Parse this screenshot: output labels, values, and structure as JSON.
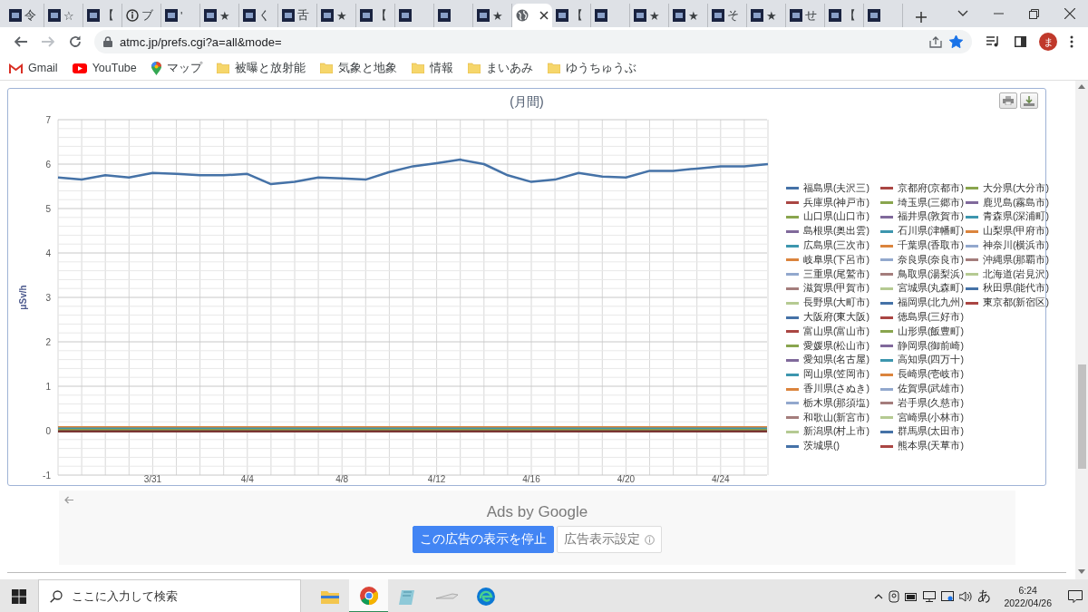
{
  "browser": {
    "tabs": [
      {
        "kind": "site",
        "title": "令",
        "selected": false
      },
      {
        "kind": "site",
        "title": "☆",
        "selected": false
      },
      {
        "kind": "site",
        "title": "【",
        "selected": false
      },
      {
        "kind": "info",
        "title": "ブ",
        "selected": false
      },
      {
        "kind": "site",
        "title": "'",
        "selected": false
      },
      {
        "kind": "site",
        "title": "★",
        "selected": false
      },
      {
        "kind": "site",
        "title": "く",
        "selected": false
      },
      {
        "kind": "site",
        "title": "舌",
        "selected": false
      },
      {
        "kind": "site",
        "title": "★",
        "selected": false
      },
      {
        "kind": "site",
        "title": "【",
        "selected": false
      },
      {
        "kind": "site",
        "selected": false
      },
      {
        "kind": "site",
        "selected": false
      },
      {
        "kind": "site",
        "title": "★",
        "selected": false
      },
      {
        "kind": "globe",
        "selected": true
      },
      {
        "kind": "site",
        "title": "【",
        "selected": false
      },
      {
        "kind": "site",
        "selected": false
      },
      {
        "kind": "site",
        "title": "★",
        "selected": false
      },
      {
        "kind": "site",
        "title": "★",
        "selected": false
      },
      {
        "kind": "site",
        "title": "そ",
        "selected": false
      },
      {
        "kind": "site",
        "title": "★",
        "selected": false
      },
      {
        "kind": "site",
        "title": "せ",
        "selected": false
      },
      {
        "kind": "site",
        "title": "【",
        "selected": false
      },
      {
        "kind": "site",
        "selected": false
      }
    ],
    "address": "atmc.jp/prefs.cgi?a=all&mode=",
    "bookmarked": true,
    "profile": "ま",
    "bookmarks": [
      {
        "kind": "gmail",
        "label": "Gmail"
      },
      {
        "kind": "youtube",
        "label": "YouTube"
      },
      {
        "kind": "maps",
        "label": "マップ"
      },
      {
        "kind": "folder",
        "label": "被曝と放射能"
      },
      {
        "kind": "folder",
        "label": "気象と地象"
      },
      {
        "kind": "folder",
        "label": "情報"
      },
      {
        "kind": "folder",
        "label": "まいあみ"
      },
      {
        "kind": "folder",
        "label": "ゆうちゅうぶ"
      }
    ]
  },
  "chart": {
    "chart_data": {
      "type": "line",
      "title": "(月間)",
      "ylabel": "μSv/h",
      "grid": true,
      "categories": [
        null,
        null,
        null,
        null,
        "3/31",
        null,
        null,
        null,
        "4/4",
        null,
        null,
        null,
        "4/8",
        null,
        null,
        null,
        "4/12",
        null,
        null,
        null,
        "4/16",
        null,
        null,
        null,
        "4/20",
        null,
        null,
        null,
        "4/24",
        null,
        null
      ],
      "ylim": [
        -1,
        7
      ],
      "yticks": [
        -1,
        0,
        1,
        2,
        3,
        4,
        5,
        6,
        7
      ],
      "series": [
        {
          "name": "福島県(夫沢三)",
          "color": "#4572a7",
          "values": [
            5.7,
            5.65,
            5.75,
            5.7,
            5.8,
            5.78,
            5.75,
            5.75,
            5.78,
            5.55,
            5.6,
            5.7,
            5.68,
            5.65,
            5.82,
            5.95,
            6.02,
            6.1,
            6.0,
            5.75,
            5.6,
            5.65,
            5.8,
            5.72,
            5.7,
            5.85,
            5.85,
            5.9,
            5.95,
            5.95,
            6.0
          ]
        }
      ]
    },
    "legend": [
      {
        "name": "京都府(京都市)",
        "color": "#aa4643"
      },
      {
        "name": "大分県(大分市)",
        "color": "#89a54e"
      },
      {
        "name": "兵庫県(神戸市)",
        "color": "#aa4643"
      },
      {
        "name": "埼玉県(三郷市)",
        "color": "#89a54e"
      },
      {
        "name": "鹿児島(霧島市)",
        "color": "#80699b"
      },
      {
        "name": "山口県(山口市)",
        "color": "#89a54e"
      },
      {
        "name": "福井県(敦賀市)",
        "color": "#80699b"
      },
      {
        "name": "青森県(深浦町)",
        "color": "#3d96ae"
      },
      {
        "name": "島根県(奥出雲)",
        "color": "#80699b"
      },
      {
        "name": "石川県(津幡町)",
        "color": "#3d96ae"
      },
      {
        "name": "山梨県(甲府市)",
        "color": "#db843d"
      },
      {
        "name": "広島県(三次市)",
        "color": "#3d96ae"
      },
      {
        "name": "千葉県(香取市)",
        "color": "#db843d"
      },
      {
        "name": "神奈川(横浜市)",
        "color": "#92a8cd"
      },
      {
        "name": "岐阜県(下呂市)",
        "color": "#db843d"
      },
      {
        "name": "奈良県(奈良市)",
        "color": "#92a8cd"
      },
      {
        "name": "沖縄県(那覇市)",
        "color": "#a47d7c"
      },
      {
        "name": "三重県(尾鷲市)",
        "color": "#92a8cd"
      },
      {
        "name": "鳥取県(湯梨浜)",
        "color": "#a47d7c"
      },
      {
        "name": "北海道(岩見沢)",
        "color": "#b5ca92"
      },
      {
        "name": "滋賀県(甲賀市)",
        "color": "#a47d7c"
      },
      {
        "name": "宮城県(丸森町)",
        "color": "#b5ca92"
      },
      {
        "name": "秋田県(能代市)",
        "color": "#4572a7"
      },
      {
        "name": "長野県(大町市)",
        "color": "#b5ca92"
      },
      {
        "name": "福岡県(北九州)",
        "color": "#4572a7"
      },
      {
        "name": "東京都(新宿区)",
        "color": "#aa4643"
      },
      {
        "name": "大阪府(東大阪)",
        "color": "#4572a7"
      },
      {
        "name": "徳島県(三好市)",
        "color": "#aa4643"
      },
      {
        "name": "富山県(富山市)",
        "color": "#aa4643"
      },
      {
        "name": "山形県(飯豊町)",
        "color": "#89a54e"
      },
      {
        "name": "愛媛県(松山市)",
        "color": "#89a54e"
      },
      {
        "name": "静岡県(御前崎)",
        "color": "#80699b"
      },
      {
        "name": "愛知県(名古屋)",
        "color": "#80699b"
      },
      {
        "name": "高知県(四万十)",
        "color": "#3d96ae"
      },
      {
        "name": "岡山県(笠岡市)",
        "color": "#3d96ae"
      },
      {
        "name": "長崎県(壱岐市)",
        "color": "#db843d"
      },
      {
        "name": "香川県(さぬき)",
        "color": "#db843d"
      },
      {
        "name": "佐賀県(武雄市)",
        "color": "#92a8cd"
      },
      {
        "name": "栃木県(那須塩)",
        "color": "#92a8cd"
      },
      {
        "name": "岩手県(久慈市)",
        "color": "#a47d7c"
      },
      {
        "name": "和歌山(新宮市)",
        "color": "#a47d7c"
      },
      {
        "name": "宮崎県(小林市)",
        "color": "#b5ca92"
      },
      {
        "name": "新潟県(村上市)",
        "color": "#b5ca92"
      },
      {
        "name": "群馬県(太田市)",
        "color": "#4572a7"
      },
      {
        "name": "茨城県()",
        "color": "#4572a7"
      },
      {
        "name": "熊本県(天草市)",
        "color": "#aa4643"
      }
    ]
  },
  "ads": {
    "label": "Ads by Google",
    "buttons": [
      {
        "kind": "primary",
        "label": "この広告の表示を停止"
      },
      {
        "kind": "secondary",
        "label": "広告表示設定"
      }
    ]
  },
  "taskbar": {
    "search_placeholder": "ここに入力して検索",
    "ime": "あ",
    "time": "6:24",
    "date": "2022/04/26"
  }
}
